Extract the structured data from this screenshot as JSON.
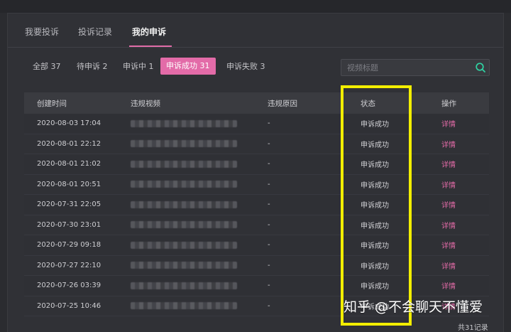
{
  "main_tabs": [
    {
      "label": "我要投诉"
    },
    {
      "label": "投诉记录"
    },
    {
      "label": "我的申诉"
    }
  ],
  "status_tabs": [
    {
      "label": "全部 37"
    },
    {
      "label": "待申诉 2"
    },
    {
      "label": "申诉中 1"
    },
    {
      "label": "申诉成功 31"
    },
    {
      "label": "申诉失败 3"
    }
  ],
  "search": {
    "placeholder": "视频标题",
    "value": ""
  },
  "table": {
    "headers": {
      "time": "创建时间",
      "video": "违规视频",
      "reason": "违规原因",
      "status": "状态",
      "operation": "操作"
    },
    "rows": [
      {
        "time": "2020-08-03 17:04",
        "reason": "-",
        "status": "申诉成功",
        "action": "详情"
      },
      {
        "time": "2020-08-01 22:12",
        "reason": "-",
        "status": "申诉成功",
        "action": "详情"
      },
      {
        "time": "2020-08-01 21:02",
        "reason": "-",
        "status": "申诉成功",
        "action": "详情"
      },
      {
        "time": "2020-08-01 20:51",
        "reason": "-",
        "status": "申诉成功",
        "action": "详情"
      },
      {
        "time": "2020-07-31 22:05",
        "reason": "-",
        "status": "申诉成功",
        "action": "详情"
      },
      {
        "time": "2020-07-30 23:01",
        "reason": "-",
        "status": "申诉成功",
        "action": "详情"
      },
      {
        "time": "2020-07-29 09:18",
        "reason": "-",
        "status": "申诉成功",
        "action": "详情"
      },
      {
        "time": "2020-07-27 22:10",
        "reason": "-",
        "status": "申诉成功",
        "action": "详情"
      },
      {
        "time": "2020-07-26 03:39",
        "reason": "-",
        "status": "申诉成功",
        "action": "详情"
      },
      {
        "time": "2020-07-25 10:46",
        "reason": "-",
        "status": "申诉成功",
        "action": "详情"
      }
    ]
  },
  "footer": {
    "count": "共31记录"
  },
  "watermark": {
    "text": "知乎 @不会聊天不懂爱"
  },
  "colors": {
    "accent": "#e36ba8",
    "highlight": "#f2ee00",
    "background": "#2b2c30"
  },
  "icons": {
    "search": "search-icon"
  }
}
